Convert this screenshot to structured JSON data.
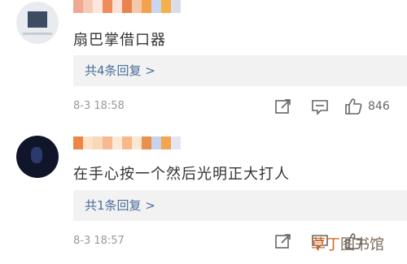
{
  "comments": [
    {
      "avatar": "avatar-photo",
      "username_pixel_colors": [
        "#f0a890",
        "#f4cbb8",
        "#fbe7dd",
        "#f08c5c",
        "#fbe2d4",
        "#e8834e",
        "#f6c8a8",
        "#f3a14a",
        "#c8d6f0",
        "#f5b04a",
        "#d8dde8"
      ],
      "text": "扇巴掌借口器",
      "replies_label": "共4条回复 >",
      "date": "8-3 18:58",
      "likes": "846"
    },
    {
      "avatar": "avatar-photo",
      "username_pixel_colors": [
        "#ee8545",
        "#fde2c8",
        "#f8d8b8",
        "#f6b990",
        "#fbe8d6",
        "#f6b98a",
        "#fde7d2",
        "#e9914c",
        "#c7d3ec",
        "#f4a34e",
        "#e2e6f2"
      ],
      "text": "在手心按一个然后光明正大打人",
      "replies_label": "共1条回复 >",
      "date": "8-3 18:57",
      "likes": ""
    }
  ],
  "icons": {
    "forward": "share-icon",
    "comment": "comment-icon",
    "like": "thumbs-up-icon"
  },
  "colors": {
    "accent_link": "#4a6f9c",
    "meta_gray": "#999999",
    "reply_bg": "#f2f2f2"
  },
  "watermark": {
    "highlight": "草丁",
    "rest": "图书馆"
  }
}
